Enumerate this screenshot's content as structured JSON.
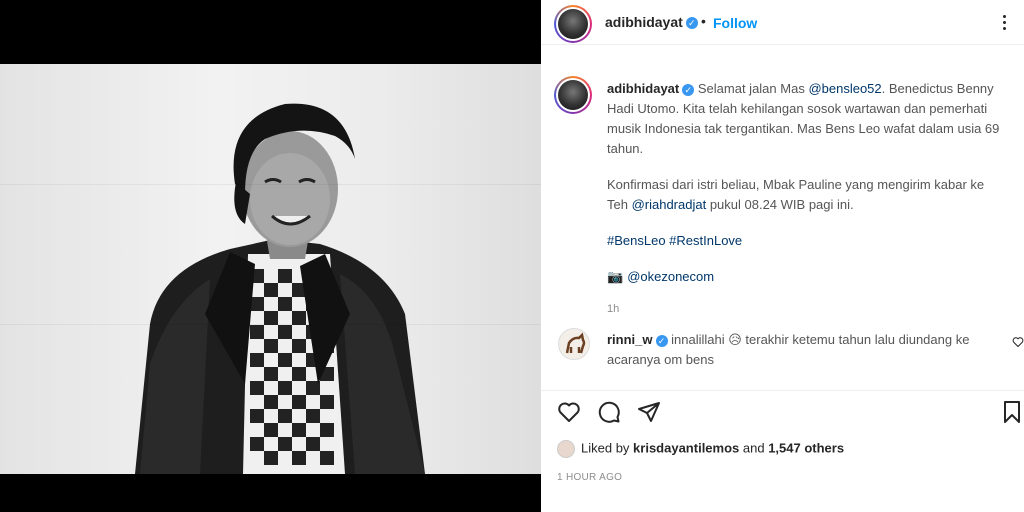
{
  "header": {
    "username": "adibhidayat",
    "separator": "•",
    "follow_label": "Follow"
  },
  "caption": {
    "username": "adibhidayat",
    "para1_before": "Selamat jalan Mas ",
    "mention1": "@bensleo52",
    "para1_after": ". Benedictus Benny Hadi Utomo. Kita telah kehilangan sosok wartawan dan pemerhati musik Indonesia tak tergantikan. Mas Bens Leo wafat dalam usia 69 tahun.",
    "para2_before": "Konfirmasi dari istri beliau, Mbak Pauline yang mengirim kabar ke Teh ",
    "mention2": "@riahdradjat",
    "para2_after": " pukul 08.24 WIB pagi ini.",
    "hashtags": "#BensLeo #RestInLove",
    "credit": "@okezonecom",
    "time": "1h"
  },
  "comment": {
    "username": "rinni_w",
    "text": "innalillahi 😥 terakhir ketemu tahun lalu diundang ke acaranya om bens"
  },
  "likes": {
    "prefix": "Liked by ",
    "user": "krisdayantilemos",
    "middle": " and ",
    "count": "1,547 others"
  },
  "post_time": "1 HOUR AGO",
  "icons": [
    "more-icon",
    "verified-icon",
    "heart-icon",
    "comment-icon",
    "share-icon",
    "save-icon",
    "camera-icon"
  ],
  "colors": {
    "accent": "#0095f6",
    "verified": "#3897f0",
    "muted": "#8e8e8e"
  }
}
